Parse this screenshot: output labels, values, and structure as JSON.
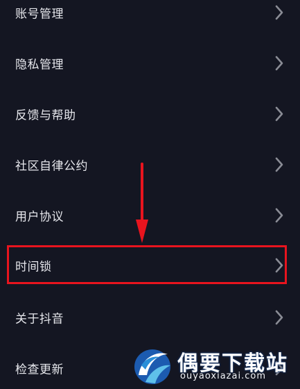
{
  "menu": {
    "items": [
      {
        "label": "账号管理"
      },
      {
        "label": "隐私管理"
      },
      {
        "label": "反馈与帮助"
      },
      {
        "label": "社区自律公约"
      },
      {
        "label": "用户协议"
      },
      {
        "label": "时间锁"
      },
      {
        "label": "关于抖音"
      },
      {
        "label": "检查更新"
      }
    ]
  },
  "annotation": {
    "highlighted_item": "时间锁",
    "color": "#e8141e"
  },
  "watermark": {
    "title": "偶要下载站",
    "url": "ouyaoxiazai.com"
  },
  "colors": {
    "background": "#141622",
    "text": "#e6e7ec",
    "chevron": "#8a8c95"
  }
}
